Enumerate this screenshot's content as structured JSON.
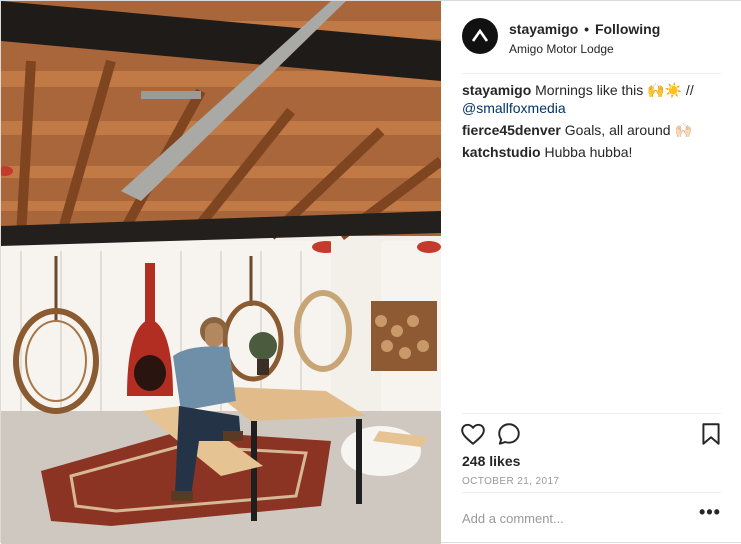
{
  "post": {
    "username": "stayamigo",
    "separator": "•",
    "follow_label": "Following",
    "location": "Amigo Motor Lodge",
    "caption": {
      "user": "stayamigo",
      "text": "Mornings like this 🙌☀️ //",
      "mention": "@smallfoxmedia"
    },
    "comments": [
      {
        "user": "fierce45denver",
        "text": "Goals, all around 🙌🏻"
      },
      {
        "user": "katchstudio",
        "text": "Hubba hubba!"
      }
    ],
    "likes": "248 likes",
    "date": "OCTOBER 21, 2017",
    "add_comment_placeholder": "Add a comment...",
    "more_label": "•••"
  },
  "icons": {
    "like": "heart-icon",
    "comment": "speech-bubble-icon",
    "save": "bookmark-icon",
    "avatar": "chevron-up-logo"
  },
  "colors": {
    "text": "#262626",
    "muted": "#999999",
    "link": "#003569",
    "divider": "#efefef"
  }
}
